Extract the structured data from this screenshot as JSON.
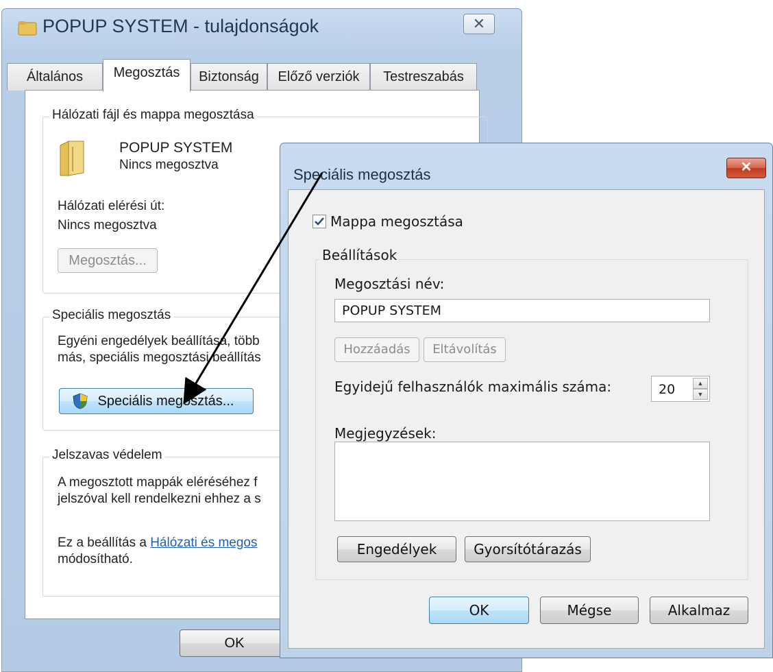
{
  "back_window": {
    "title": "POPUP SYSTEM - tulajdonságok",
    "close_glyph": "✕",
    "tabs": [
      "Általános",
      "Megosztás",
      "Biztonság",
      "Előző verziók",
      "Testreszabás"
    ],
    "network_group": {
      "legend": "Hálózati fájl és mappa megosztása",
      "folder_name": "POPUP SYSTEM",
      "folder_status": "Nincs megosztva",
      "path_label": "Hálózati elérési út:",
      "path_value": "Nincs megosztva",
      "share_button": "Megosztás..."
    },
    "advanced_group": {
      "legend": "Speciális megosztás",
      "line1": "Egyéni engedélyek beállítása, több",
      "line2": "más, speciális megosztási beállítás",
      "button": "Speciális megosztás..."
    },
    "password_group": {
      "legend": "Jelszavas védelem",
      "line1": "A megosztott mappák eléréséhez f",
      "line2": "jelszóval kell rendelkezni ehhez a s",
      "line3_prefix": "Ez a beállítás a ",
      "line3_link": "Hálózati és megos",
      "line4": "módosítható."
    },
    "ok_button": "OK"
  },
  "dialog": {
    "title": "Speciális megosztás",
    "close_glyph": "✕",
    "share_checkbox_label": "Mappa megosztása",
    "share_checked": true,
    "settings_legend": "Beállítások",
    "share_name_label": "Megosztási név:",
    "share_name_value": "POPUP SYSTEM",
    "add_button": "Hozzáadás",
    "remove_button": "Eltávolítás",
    "max_users_label": "Egyidejű felhasználók maximális száma:",
    "max_users_value": "20",
    "comments_label": "Megjegyzések:",
    "comments_value": "",
    "permissions_button": "Engedélyek",
    "caching_button": "Gyorsítótárazás",
    "ok_button": "OK",
    "cancel_button": "Mégse",
    "apply_button": "Alkalmaz"
  }
}
